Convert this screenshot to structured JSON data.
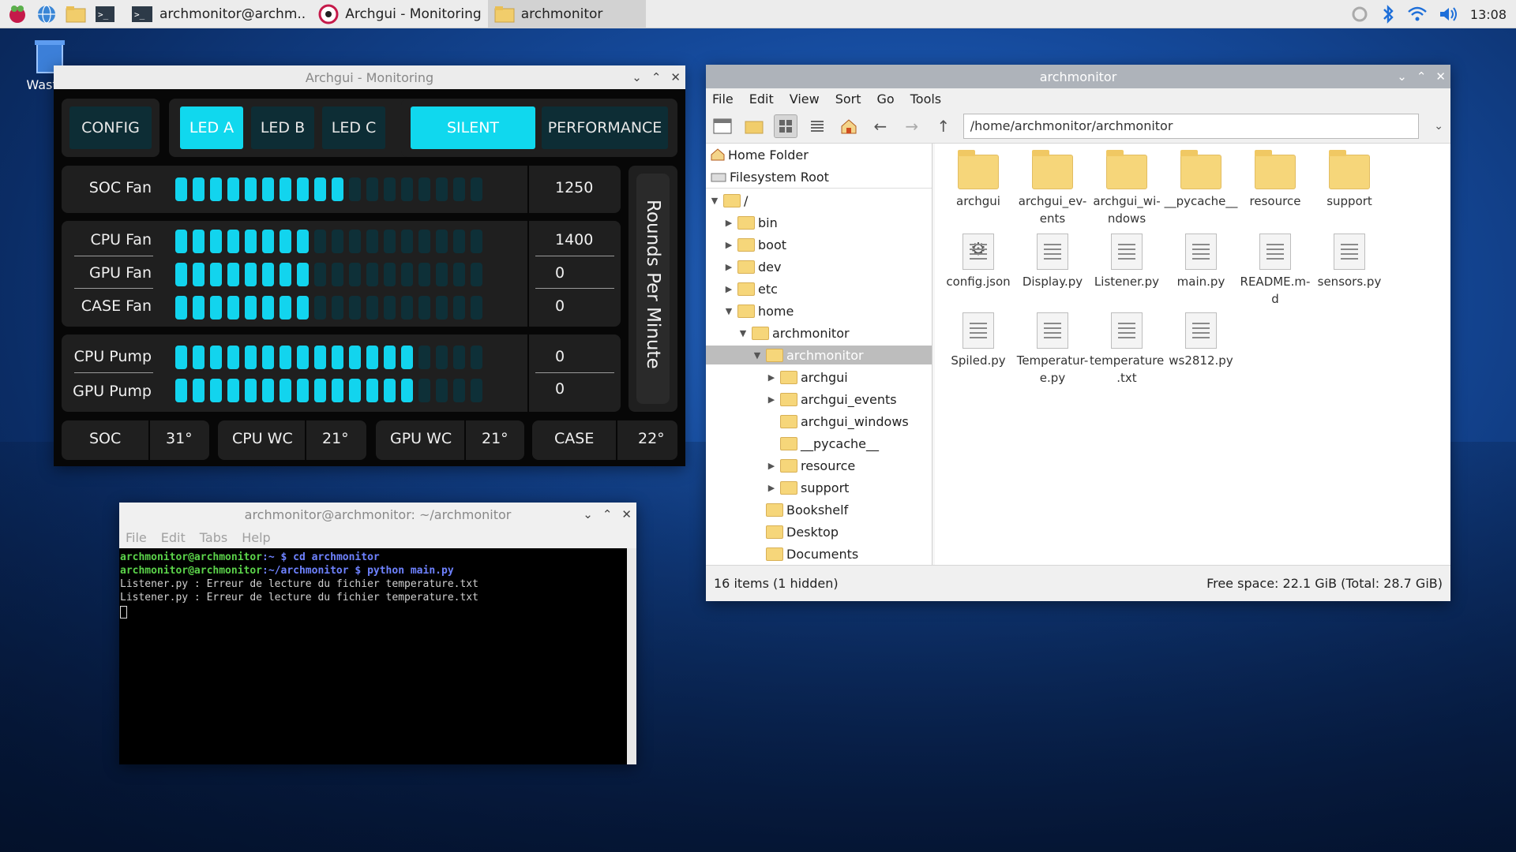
{
  "taskbar": {
    "tasks": [
      {
        "label": "archmonitor@archm..",
        "icon": "terminal-icon"
      },
      {
        "label": "Archgui - Monitoring",
        "icon": "app-icon"
      },
      {
        "label": "archmonitor",
        "icon": "folder-icon"
      }
    ],
    "clock": "13:08"
  },
  "desktop": {
    "trash_label": "Wasteb"
  },
  "archgui": {
    "title": "Archgui - Monitoring",
    "buttons": {
      "config": "CONFIG",
      "led_a": "LED A",
      "led_b": "LED B",
      "led_c": "LED C",
      "silent": "SILENT",
      "performance": "PERFORMANCE"
    },
    "side_label": "Rounds Per Minute",
    "fans": [
      {
        "label": "SOC Fan",
        "value": "1250",
        "level": 0.55
      },
      {
        "label": "CPU Fan",
        "value": "1400",
        "level": 0.45
      },
      {
        "label": "GPU Fan",
        "value": "0",
        "level": 0.45
      },
      {
        "label": "CASE Fan",
        "value": "0",
        "level": 0.45
      },
      {
        "label": "CPU Pump",
        "value": "0",
        "level": 0.75
      },
      {
        "label": "GPU Pump",
        "value": "0",
        "level": 0.75
      }
    ],
    "temps": [
      {
        "label": "SOC",
        "value": "31°"
      },
      {
        "label": "CPU WC",
        "value": "21°"
      },
      {
        "label": "GPU WC",
        "value": "21°"
      },
      {
        "label": "CASE",
        "value": "22°"
      }
    ]
  },
  "terminal": {
    "title": "archmonitor@archmonitor: ~/archmonitor",
    "menu": [
      "File",
      "Edit",
      "Tabs",
      "Help"
    ],
    "lines": [
      {
        "user": "archmonitor@archmonitor",
        "path": ":~",
        "cmd": " $ cd archmonitor"
      },
      {
        "user": "archmonitor@archmonitor",
        "path": ":~/archmonitor",
        "cmd": " $ python main.py"
      },
      {
        "text": "Listener.py : Erreur de lecture du fichier temperature.txt"
      },
      {
        "text": "Listener.py : Erreur de lecture du fichier temperature.txt"
      }
    ]
  },
  "filemanager": {
    "title": "archmonitor",
    "menu": [
      "File",
      "Edit",
      "View",
      "Sort",
      "Go",
      "Tools"
    ],
    "address": "/home/archmonitor/archmonitor",
    "places": [
      "Home Folder",
      "Filesystem Root"
    ],
    "tree": [
      {
        "label": "/",
        "depth": 0,
        "arrow": "open"
      },
      {
        "label": "bin",
        "depth": 1,
        "arrow": "closed"
      },
      {
        "label": "boot",
        "depth": 1,
        "arrow": "closed"
      },
      {
        "label": "dev",
        "depth": 1,
        "arrow": "closed"
      },
      {
        "label": "etc",
        "depth": 1,
        "arrow": "closed"
      },
      {
        "label": "home",
        "depth": 1,
        "arrow": "open"
      },
      {
        "label": "archmonitor",
        "depth": 2,
        "arrow": "open"
      },
      {
        "label": "archmonitor",
        "depth": 3,
        "arrow": "open",
        "selected": true
      },
      {
        "label": "archgui",
        "depth": 4,
        "arrow": "closed"
      },
      {
        "label": "archgui_events",
        "depth": 4,
        "arrow": "closed"
      },
      {
        "label": "archgui_windows",
        "depth": 4,
        "arrow": "none"
      },
      {
        "label": "__pycache__",
        "depth": 4,
        "arrow": "none"
      },
      {
        "label": "resource",
        "depth": 4,
        "arrow": "closed"
      },
      {
        "label": "support",
        "depth": 4,
        "arrow": "closed"
      },
      {
        "label": "Bookshelf",
        "depth": 3,
        "arrow": "none"
      },
      {
        "label": "Desktop",
        "depth": 3,
        "arrow": "none"
      },
      {
        "label": "Documents",
        "depth": 3,
        "arrow": "none"
      }
    ],
    "items": [
      {
        "name": "archgui",
        "kind": "folder"
      },
      {
        "name": "archgui_ev-\nents",
        "kind": "folder"
      },
      {
        "name": "archgui_wi-\nndows",
        "kind": "folder"
      },
      {
        "name": "__pycache__",
        "kind": "folder"
      },
      {
        "name": "resource",
        "kind": "folder"
      },
      {
        "name": "support",
        "kind": "folder"
      },
      {
        "name": "config.json",
        "kind": "config"
      },
      {
        "name": "Display.py",
        "kind": "file"
      },
      {
        "name": "Listener.py",
        "kind": "file"
      },
      {
        "name": "main.py",
        "kind": "file"
      },
      {
        "name": "README.m-\nd",
        "kind": "file"
      },
      {
        "name": "sensors.py",
        "kind": "file"
      },
      {
        "name": "Spiled.py",
        "kind": "file"
      },
      {
        "name": "Temperatur-\ne.py",
        "kind": "file"
      },
      {
        "name": "temperature\n.txt",
        "kind": "file"
      },
      {
        "name": "ws2812.py",
        "kind": "file"
      }
    ],
    "status_left": "16 items (1 hidden)",
    "status_right": "Free space: 22.1 GiB (Total: 28.7 GiB)"
  }
}
